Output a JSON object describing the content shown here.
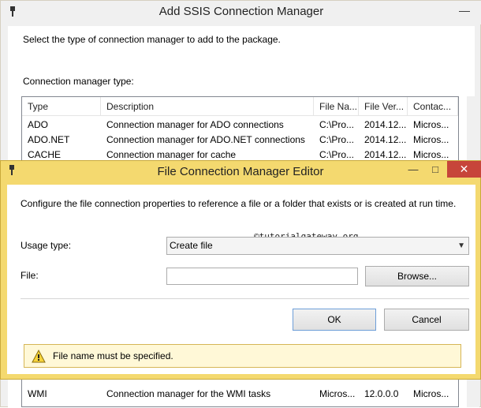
{
  "back_window": {
    "title": "Add SSIS Connection Manager",
    "minimize_label": "—",
    "instruction": "Select the type of connection manager to add to the package.",
    "list_label": "Connection manager type:",
    "columns": [
      "Type",
      "Description",
      "File Na...",
      "File Ver...",
      "Contac..."
    ],
    "rows": [
      [
        "ADO",
        "Connection manager for ADO connections",
        "C:\\Pro...",
        "2014.12...",
        "Micros..."
      ],
      [
        "ADO.NET",
        "Connection manager for ADO.NET connections",
        "C:\\Pro...",
        "2014.12...",
        "Micros..."
      ],
      [
        "CACHE",
        "Connection manager for cache",
        "C:\\Pro...",
        "2014.12...",
        "Micros..."
      ]
    ],
    "last_row": [
      "WMI",
      "Connection manager for the WMI tasks",
      "Micros...",
      "12.0.0.0",
      "Micros..."
    ]
  },
  "dialog": {
    "title": "File Connection Manager Editor",
    "minimize_label": "—",
    "maximize_label": "□",
    "close_label": "✕",
    "instruction": "Configure the file connection properties to reference a file or a folder that exists or is created at run time.",
    "watermark": "©tutorialgateway.org",
    "usage_label": "Usage type:",
    "usage_value": "Create file",
    "file_label": "File:",
    "file_value": "",
    "browse_label": "Browse...",
    "ok_label": "OK",
    "cancel_label": "Cancel",
    "warning_text": "File name must be specified."
  }
}
